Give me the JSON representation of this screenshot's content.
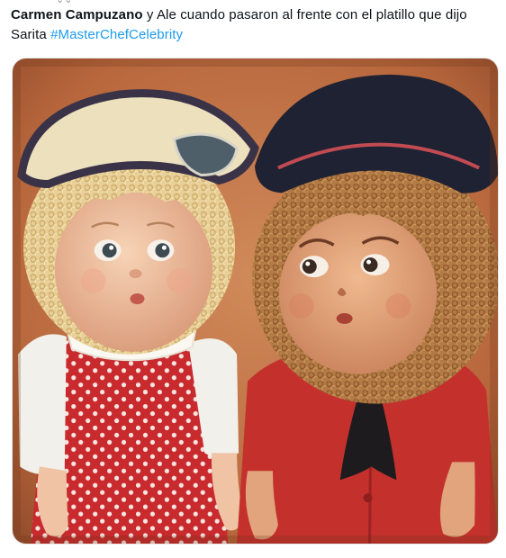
{
  "tweet": {
    "author_name": "Carmen Campuzano",
    "text_body": " y Ale cuando pasaron al frente con el platillo que dijo Sarita ",
    "hashtag": "#MasterChefCelebrity",
    "image_alt": "Dos muñecas antiguas: una rubia con sombrero crema y vestido rojo de lunares blancos, otra de pelo castaño rizado con boina negra, abrigo rojo y moño negro, mirándose de reojo"
  },
  "colors": {
    "text": "#0f1419",
    "hashtag": "#1d9bf0",
    "background": "#ffffff",
    "photo_backdrop": "#c07548",
    "dress_red": "#c82a2e",
    "coat_red": "#c4312d"
  }
}
